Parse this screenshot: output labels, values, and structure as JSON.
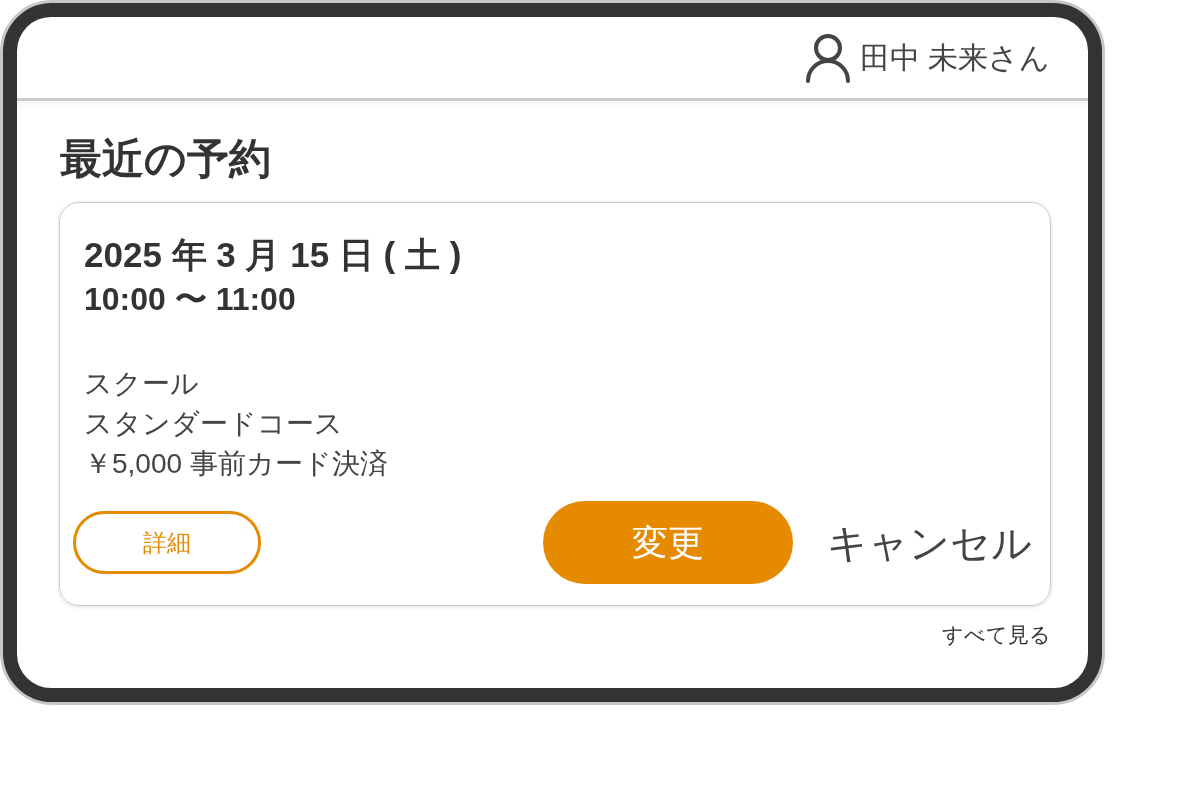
{
  "header": {
    "user_name": "田中 未来さん"
  },
  "section": {
    "title": "最近の予約"
  },
  "reservation_card": {
    "date": "2025 年 3 月 15 日 ( 土 )",
    "time": "10:00 〜 11:00",
    "lines": [
      "スクール",
      "スタンダードコース",
      "￥5,000 事前カード決済"
    ],
    "details_button": "詳細",
    "change_button": "変更",
    "cancel_button": "キャンセル"
  },
  "see_all_link": "すべて見る"
}
